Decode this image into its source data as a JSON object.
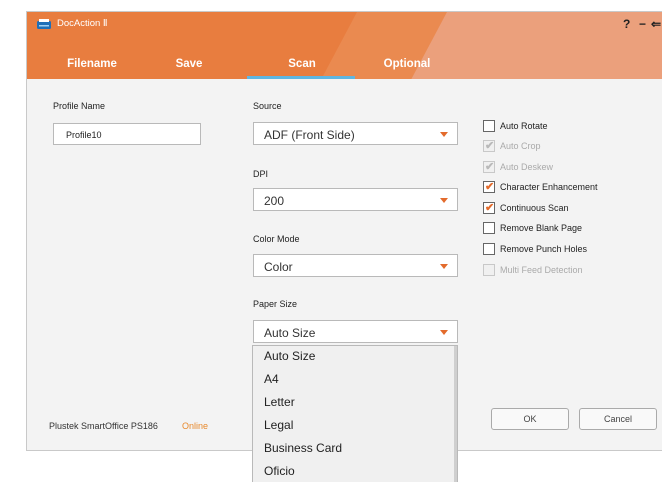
{
  "window": {
    "title": "DocAction Ⅱ"
  },
  "titlebar": {
    "help": "?",
    "minimize": "−",
    "back": "⇐"
  },
  "tabs": [
    {
      "label": "Filename",
      "active": false
    },
    {
      "label": "Save",
      "active": false
    },
    {
      "label": "Scan",
      "active": true
    },
    {
      "label": "Optional",
      "active": false
    }
  ],
  "profile": {
    "label": "Profile Name",
    "value": "Profile10"
  },
  "source": {
    "label": "Source",
    "value": "ADF (Front Side)"
  },
  "dpi": {
    "label": "DPI",
    "value": "200"
  },
  "color_mode": {
    "label": "Color Mode",
    "value": "Color"
  },
  "paper_size": {
    "label": "Paper Size",
    "value": "Auto Size",
    "options": [
      "Auto Size",
      "A4",
      "Letter",
      "Legal",
      "Business Card",
      "Oficio"
    ]
  },
  "options": [
    {
      "label": "Auto Rotate",
      "checked": false,
      "enabled": true
    },
    {
      "label": "Auto Crop",
      "checked": true,
      "enabled": false
    },
    {
      "label": "Auto Deskew",
      "checked": true,
      "enabled": false
    },
    {
      "label": "Character Enhancement",
      "checked": true,
      "enabled": true
    },
    {
      "label": "Continuous Scan",
      "checked": true,
      "enabled": true
    },
    {
      "label": "Remove Blank Page",
      "checked": false,
      "enabled": true
    },
    {
      "label": "Remove Punch Holes",
      "checked": false,
      "enabled": true
    },
    {
      "label": "Multi Feed Detection",
      "checked": false,
      "enabled": false
    }
  ],
  "footer": {
    "device": "Plustek SmartOffice PS186",
    "status": "Online"
  },
  "buttons": {
    "ok": "OK",
    "cancel": "Cancel"
  },
  "colors": {
    "accent": "#e87d3f",
    "tab_underline": "#5fb6e2",
    "check": "#e36b2c",
    "status": "#e8892c"
  }
}
